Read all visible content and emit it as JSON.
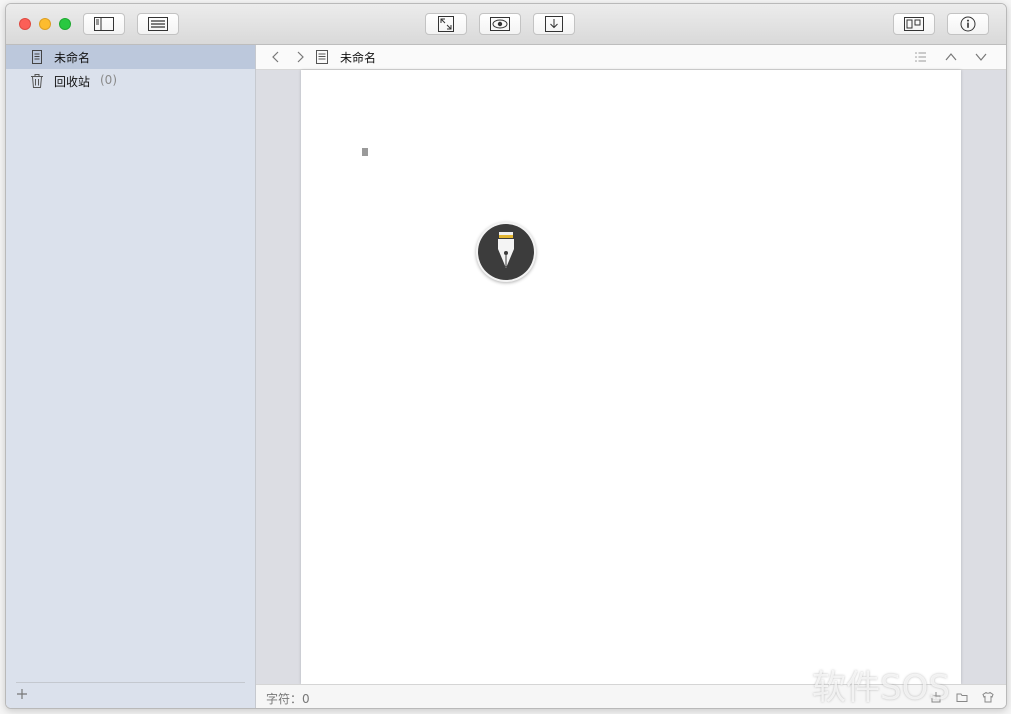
{
  "sidebar": {
    "items": [
      {
        "label": "未命名",
        "icon": "document-icon",
        "selected": true
      },
      {
        "label": "回收站",
        "count": "(0)",
        "icon": "trash-icon",
        "selected": false
      }
    ]
  },
  "navbar": {
    "title": "未命名"
  },
  "editor": {
    "content": ""
  },
  "status": {
    "char_count": "字符：0"
  },
  "watermark": {
    "text": "软件SOS"
  },
  "colors": {
    "sidebar_bg": "#dbe1ec",
    "selected_bg": "#bcc8dc",
    "close": "#fc5f57",
    "minimize": "#fdbc2e",
    "maximize": "#29c840"
  }
}
